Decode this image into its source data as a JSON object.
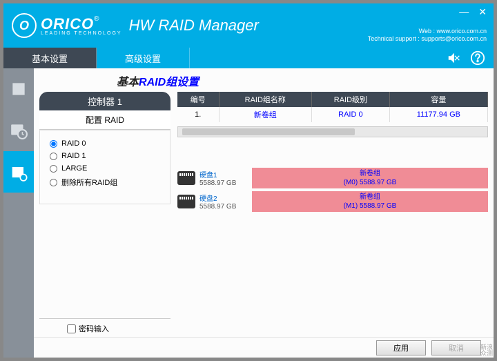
{
  "header": {
    "brand": "ORICO",
    "brand_sub": "LEADING TECHNOLOGY",
    "app_title": "HW RAID Manager",
    "web_label": "Web : www.orico.com.cn",
    "support_label": "Technical support : supports@orico.com.cn"
  },
  "tabs": {
    "basic": "基本设置",
    "advanced": "高级设置"
  },
  "section": {
    "title_pre": "基本",
    "title_main": "RAID组设置"
  },
  "controller": {
    "header": "控制器 1",
    "sub": "配置 RAID",
    "options": {
      "raid0": "RAID 0",
      "raid1": "RAID 1",
      "large": "LARGE",
      "delete": "删除所有RAID组"
    },
    "selected": "raid0",
    "password_label": "密码输入"
  },
  "table": {
    "headers": {
      "id": "编号",
      "name": "RAID组名称",
      "level": "RAID级别",
      "cap": "容量"
    },
    "rows": [
      {
        "id": "1.",
        "name": "新卷组",
        "level": "RAID 0",
        "cap": "11177.94 GB"
      }
    ]
  },
  "drives": [
    {
      "name": "硬盘1",
      "size": "5588.97 GB",
      "group": "新卷组",
      "detail": "(M0) 5588.97 GB"
    },
    {
      "name": "硬盘2",
      "size": "5588.97 GB",
      "group": "新卷组",
      "detail": "(M1) 5588.97 GB"
    }
  ],
  "footer": {
    "apply": "应用",
    "cancel": "取消"
  },
  "watermark": {
    "line1": "新浪",
    "line2": "众测"
  }
}
